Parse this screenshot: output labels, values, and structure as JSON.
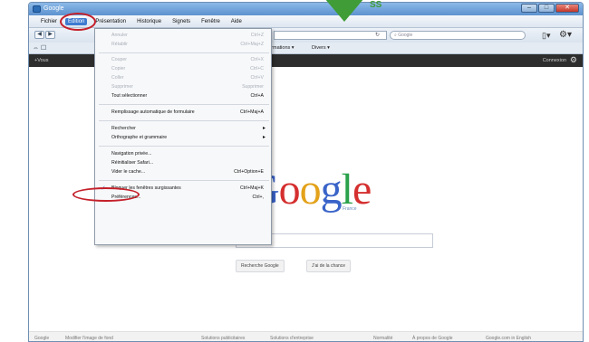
{
  "window": {
    "title": "Google"
  },
  "menubar": {
    "items": [
      "Fichier",
      "Édition",
      "Présentation",
      "Historique",
      "Signets",
      "Fenêtre",
      "Aide"
    ],
    "active_index": 1
  },
  "toolbar": {
    "search_placeholder": "Google",
    "bookmarks": [
      "Informations ▾",
      "Divers ▾"
    ]
  },
  "gbar": {
    "left": "+Vous",
    "right": "Connexion"
  },
  "edit_menu": {
    "items": [
      {
        "label": "Annuler",
        "shortcut": "Ctrl+Z",
        "disabled": true
      },
      {
        "label": "Rétablir",
        "shortcut": "Ctrl+Maj+Z",
        "disabled": true
      },
      {
        "label": "Couper",
        "shortcut": "Ctrl+X",
        "disabled": true
      },
      {
        "label": "Copier",
        "shortcut": "Ctrl+C",
        "disabled": true
      },
      {
        "label": "Coller",
        "shortcut": "Ctrl+V",
        "disabled": true
      },
      {
        "label": "Supprimer",
        "shortcut": "Supprimer",
        "disabled": true
      },
      {
        "label": "Tout sélectionner",
        "shortcut": "Ctrl+A",
        "disabled": false
      },
      {
        "label": "Remplissage automatique de formulaire",
        "shortcut": "Ctrl+Maj+A",
        "disabled": false
      },
      {
        "label": "Rechercher",
        "shortcut": "",
        "disabled": false
      },
      {
        "label": "Orthographe et grammaire",
        "shortcut": "",
        "disabled": false
      },
      {
        "label": "Navigation privée...",
        "shortcut": "",
        "disabled": false
      },
      {
        "label": "Réinitialiser Safari...",
        "shortcut": "",
        "disabled": false
      },
      {
        "label": "Vider le cache...",
        "shortcut": "Ctrl+Option+E",
        "disabled": false
      },
      {
        "label": "Bloquer les fenêtres surgissantes",
        "shortcut": "Ctrl+Maj+K",
        "disabled": false,
        "checked": true
      },
      {
        "label": "Préférences...",
        "shortcut": "Ctrl+,",
        "disabled": false
      }
    ]
  },
  "google": {
    "logo_letters": [
      "G",
      "o",
      "o",
      "g",
      "l",
      "e"
    ],
    "subtitle": "France",
    "search_button": "Recherche Google",
    "lucky_button": "J'ai de la chance"
  },
  "footer": {
    "items": [
      "Google",
      "Modifier l'image de fond",
      "Solutions publicitaires",
      "Solutions d'entreprise",
      "Normalité",
      "À propos de Google",
      "Google.com in English"
    ]
  },
  "annotation": {
    "text": "SS"
  },
  "colors": {
    "highlight": "#c4202a",
    "arrow": "#3f9c36",
    "menu_active": "#3d7bd0"
  }
}
